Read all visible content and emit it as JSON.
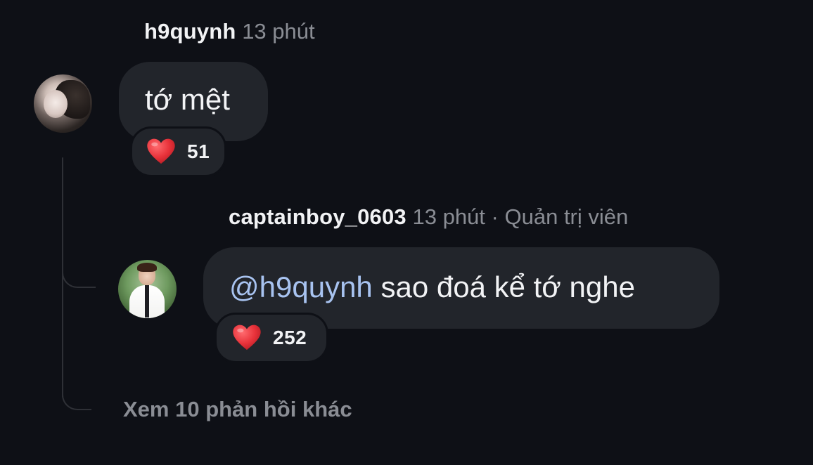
{
  "comment": {
    "username": "h9quynh",
    "time": "13 phút",
    "text": "tớ mệt",
    "reaction": {
      "icon": "heart-icon",
      "emoji_color": "#e8323a",
      "count": "51"
    }
  },
  "reply": {
    "username": "captainboy_0603",
    "time": "13 phút",
    "separator": "·",
    "role": "Quản trị viên",
    "mention": "@h9quynh",
    "text": " sao đoá kể tớ nghe",
    "reaction": {
      "icon": "heart-icon",
      "emoji_color": "#e8323a",
      "count": "252"
    }
  },
  "view_more_replies": "Xem 10 phản hồi khác",
  "colors": {
    "background": "#0e1016",
    "bubble": "#22252b",
    "mention": "#a8c3f0",
    "muted_text": "#8a8d94"
  }
}
